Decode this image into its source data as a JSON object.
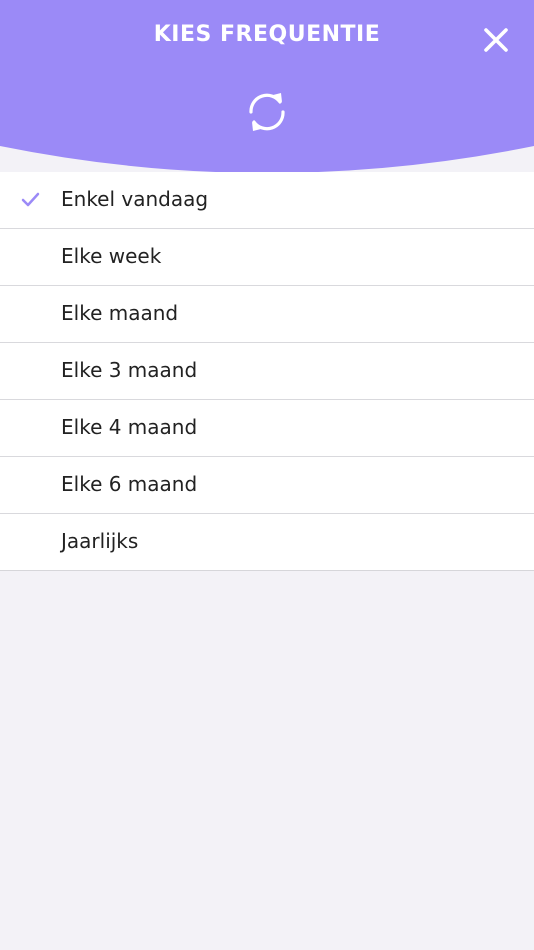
{
  "header": {
    "title": "KIES FREQUENTIE",
    "close_icon": "close-icon",
    "refresh_icon": "refresh-icon",
    "accent_color": "#9b8af7"
  },
  "frequency": {
    "selected_index": 0,
    "items": [
      {
        "label": "Enkel vandaag",
        "selected": true
      },
      {
        "label": "Elke week",
        "selected": false
      },
      {
        "label": "Elke maand",
        "selected": false
      },
      {
        "label": "Elke 3 maand",
        "selected": false
      },
      {
        "label": "Elke 4 maand",
        "selected": false
      },
      {
        "label": "Elke 6 maand",
        "selected": false
      },
      {
        "label": "Jaarlijks",
        "selected": false
      }
    ]
  }
}
